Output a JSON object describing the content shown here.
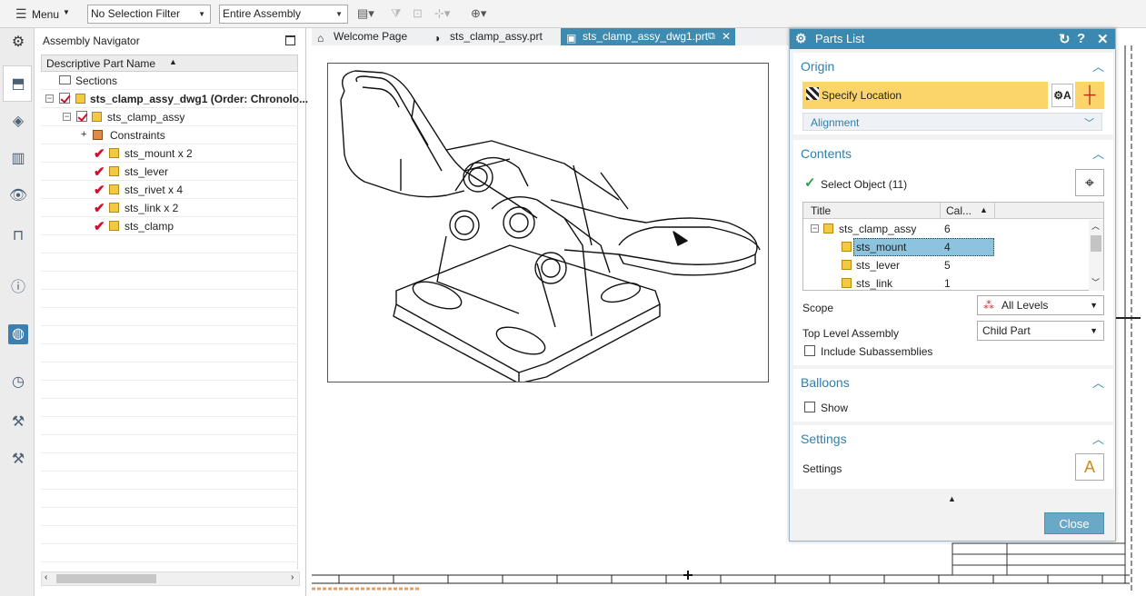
{
  "toolbar": {
    "menu_label": "Menu",
    "selection_filter": "No Selection Filter",
    "scope": "Entire Assembly"
  },
  "navigator": {
    "title": "Assembly Navigator",
    "column_header": "Descriptive Part Name",
    "rows": [
      {
        "label": "Sections",
        "bold": false
      },
      {
        "label": "sts_clamp_assy_dwg1 (Order: Chronolo...",
        "bold": true
      },
      {
        "label": "sts_clamp_assy",
        "bold": false
      },
      {
        "label": "Constraints",
        "bold": false
      },
      {
        "label": "sts_mount x 2",
        "bold": false
      },
      {
        "label": "sts_lever",
        "bold": false
      },
      {
        "label": "sts_rivet x 4",
        "bold": false
      },
      {
        "label": "sts_link x 2",
        "bold": false
      },
      {
        "label": "sts_clamp",
        "bold": false
      }
    ]
  },
  "tabs": [
    {
      "label": "Welcome Page"
    },
    {
      "label": "sts_clamp_assy.prt"
    },
    {
      "label": "sts_clamp_assy_dwg1.prt"
    }
  ],
  "dialog": {
    "title": "Parts List",
    "origin": {
      "title": "Origin",
      "specify_location": "Specify Location",
      "alignment": "Alignment"
    },
    "contents": {
      "title": "Contents",
      "select_object": "Select Object (11)",
      "table_headers": [
        "Title",
        "Cal..."
      ],
      "table_rows": [
        {
          "title": "sts_clamp_assy",
          "value": "6"
        },
        {
          "title": "sts_mount",
          "value": "4"
        },
        {
          "title": "sts_lever",
          "value": "5"
        },
        {
          "title": "sts_link",
          "value": "1"
        }
      ],
      "scope_label": "Scope",
      "scope_value": "All Levels",
      "top_level_label": "Top Level Assembly",
      "top_level_value": "Child Part",
      "include_sub": "Include Subassemblies"
    },
    "balloons": {
      "title": "Balloons",
      "show": "Show"
    },
    "settings": {
      "title": "Settings",
      "label": "Settings"
    },
    "close_label": "Close"
  }
}
